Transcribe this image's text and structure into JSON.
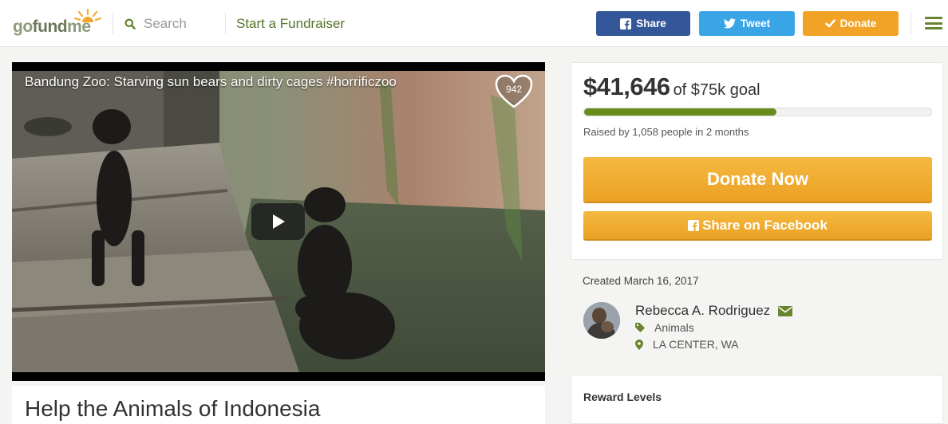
{
  "header": {
    "logo_text": "gofundme",
    "search_placeholder": "Search",
    "start_fundraiser": "Start a Fundraiser",
    "share_label": "Share",
    "tweet_label": "Tweet",
    "donate_label": "Donate"
  },
  "video": {
    "title": "Bandung Zoo: Starving sun bears and dirty cages #horrificzoo",
    "heart_count": "942"
  },
  "campaign": {
    "title": "Help the Animals of Indonesia",
    "amount_raised": "$41,646",
    "goal_text": "of $75k goal",
    "progress_fraction": 0.555,
    "raised_by": "Raised by 1,058 people in 2 months",
    "donate_now_label": "Donate Now",
    "share_facebook_label": "Share on Facebook",
    "created": "Created March 16, 2017",
    "organizer_name": "Rebecca A. Rodriguez",
    "category": "Animals",
    "location": "LA CENTER, WA",
    "reward_levels_label": "Reward Levels"
  },
  "icons": {
    "search": "search-icon",
    "facebook": "facebook-icon",
    "twitter": "twitter-icon",
    "check": "check-icon",
    "menu": "hamburger-menu-icon",
    "play": "play-icon",
    "heart": "heart-icon",
    "envelope": "envelope-icon",
    "tag": "tag-icon",
    "location": "location-pin-icon"
  },
  "colors": {
    "brand_green": "#66852e",
    "facebook_blue": "#34579a",
    "twitter_blue": "#39a4e6",
    "donate_orange": "#f0a326",
    "progress_green": "#6a8b1b"
  }
}
